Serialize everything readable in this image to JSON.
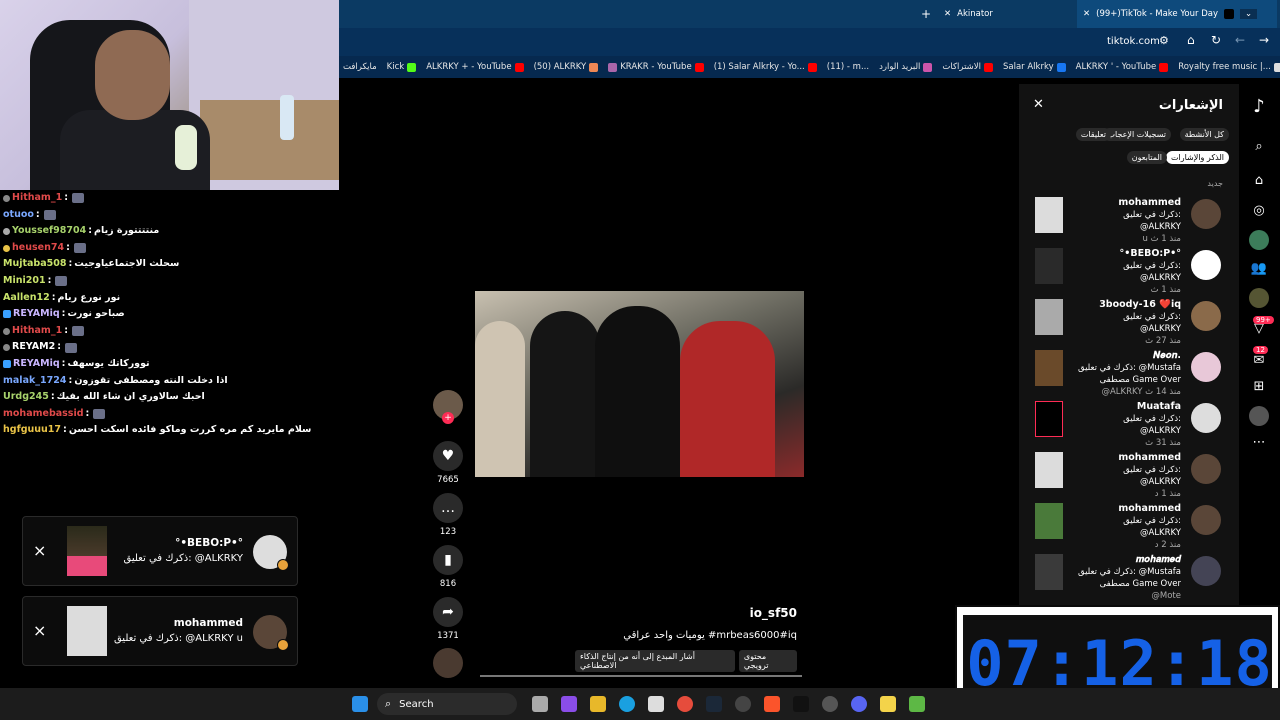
{
  "chat": [
    {
      "user": "Hitham_1",
      "color": "#e04a4a",
      "msg": "",
      "lead": "dot",
      "leadColor": "#888"
    },
    {
      "user": "otuoo",
      "color": "#7aa8ff",
      "msg": "",
      "lead": "",
      "leadColor": ""
    },
    {
      "user": "Youssef98704",
      "color": "#a7d26b",
      "msg": "منتتتتورة زيام",
      "lead": "dot",
      "leadColor": "#aaa"
    },
    {
      "user": "heusen74",
      "color": "#e04a4a",
      "msg": "",
      "lead": "dot",
      "leadColor": "#e9c347"
    },
    {
      "user": "Mujtaba508",
      "color": "#c9e36b",
      "msg": "سحلث الاجتماعياوجيت",
      "lead": "",
      "leadColor": ""
    },
    {
      "user": "Mini201",
      "color": "#c9e36b",
      "msg": "",
      "lead": "",
      "leadColor": ""
    },
    {
      "user": "Aallen12",
      "color": "#c9e36b",
      "msg": "نور نورع ريام",
      "lead": "",
      "leadColor": ""
    },
    {
      "user": "REYAMiq",
      "color": "#c9b6ff",
      "msg": "صباحو نورت",
      "lead": "badge",
      "leadColor": "#3aa0ff"
    },
    {
      "user": "Hitham_1",
      "color": "#e04a4a",
      "msg": "",
      "lead": "dot",
      "leadColor": "#888"
    },
    {
      "user": "REYAM2",
      "color": "#fff",
      "msg": "",
      "lead": "dot",
      "leadColor": "#888"
    },
    {
      "user": "REYAMiq",
      "color": "#c9b6ff",
      "msg": "تووركاتك يوسهف",
      "lead": "badge",
      "leadColor": "#3aa0ff"
    },
    {
      "user": "malak_1724",
      "color": "#7aa8ff",
      "msg": "اذا دخلت النته ومصطفى تقوزون",
      "lead": "",
      "leadColor": ""
    },
    {
      "user": "Urdg245",
      "color": "#a7d26b",
      "msg": "احبك سالاوري ان شاء الله بفيك",
      "lead": "",
      "leadColor": ""
    },
    {
      "user": "mohamebassid",
      "color": "#e04a4a",
      "msg": "",
      "lead": "",
      "leadColor": ""
    },
    {
      "user": "hgfguuu17",
      "color": "#e9c347",
      "msg": "سلام مايريد كم مره كررت وماكو فائده اسكت احسن",
      "lead": "",
      "leadColor": ""
    }
  ],
  "cards": [
    {
      "name": "°•BEBO:P•°",
      "text": "ذكرك في تعليق: @ALKRKY",
      "close": "×"
    },
    {
      "name": "mohammed",
      "text": "ذكرك في تعليق: @ALKRKY u",
      "close": "×"
    }
  ],
  "browser": {
    "tabs": [
      "Akinator",
      "(99+)TikTok - Make Your Day"
    ],
    "new_tab": "+",
    "url": "tiktok.com",
    "bookmarks": [
      "مايكرافت",
      "Kick",
      "ALKRKY + - YouTube",
      "(50) ALKRKY",
      "KRAKR - YouTube",
      "(1) Salar Alkrky - Yo...",
      "(11) - m...",
      "البريد الوارد",
      "الاشتراكات",
      "Salar Alkrky",
      "ALKRKY ' - YouTube",
      "Royalty free music |..."
    ]
  },
  "video": {
    "author": "io_sf50",
    "caption": "يوميات واحد عراقي #mrbeas6000#iq",
    "tags": [
      "محتوى ترويجي",
      "أشار المبدع إلى أنه من إنتاج الذكاء الاصطناعي"
    ],
    "likes": "7665",
    "comments": "123",
    "saves": "816",
    "shares": "1371"
  },
  "panel": {
    "title": "الإشعارات",
    "filters": [
      "كل الأنشطة",
      "تسجيلات الإعجاب",
      "تعليقات",
      "الذكر والإشارات",
      "المتابعون"
    ],
    "section": "جديد",
    "items": [
      {
        "name": "mohammed",
        "l2": "ذكرك في تعليق:",
        "l3": "@ALKRKY",
        "l4": "u منذ 1 ث"
      },
      {
        "name": "°•BEBO:P•°",
        "l2": "ذكرك في تعليق:",
        "l3": "@ALKRKY",
        "l4": "منذ 1 ث"
      },
      {
        "name": "3boody-16 ❤️iq",
        "l2": "ذكرك في تعليق:",
        "l3": "@ALKRKY",
        "l4": "منذ 27 ث"
      },
      {
        "name": "𝑵𝒆𝒐𝒏.",
        "l2": "ذكرك في تعليق: @Mustafa",
        "l3": "مصطفى Game Over",
        "l4": "@ALKRKY منذ 14 ث"
      },
      {
        "name": "Muatafa",
        "l2": "ذكرك في تعليق:",
        "l3": "@ALKRKY",
        "l4": "منذ 31 ث"
      },
      {
        "name": "mohammed",
        "l2": "ذكرك في تعليق:",
        "l3": "@ALKRKY",
        "l4": "منذ 1 د"
      },
      {
        "name": "mohammed",
        "l2": "ذكرك في تعليق:",
        "l3": "@ALKRKY",
        "l4": "منذ 2 د"
      },
      {
        "name": "𝒎𝒐𝒉𝒂𝒎𝒆𝒅",
        "l2": "ذكرك في تعليق: @Mustafa",
        "l3": "مصطفى Game Over",
        "l4": "@Mote"
      }
    ],
    "badges": [
      "99+",
      "12"
    ]
  },
  "timer": "07:12:18",
  "taskbar": {
    "search": "Search"
  },
  "colors": {
    "accent": "#fe2c55",
    "timer": "#1561e6",
    "tabbar": "#0b3a63"
  }
}
